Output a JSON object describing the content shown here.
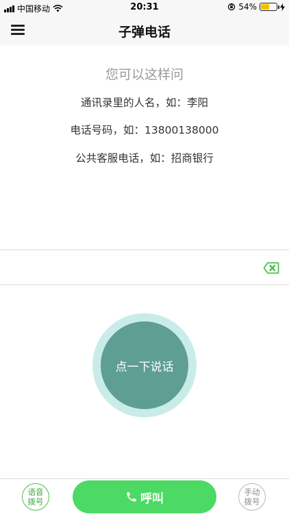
{
  "status_bar": {
    "carrier": "中国移动",
    "time": "20:31",
    "battery_percent": "54%",
    "battery_level": 0.54
  },
  "nav": {
    "title": "子弹电话",
    "menu_icon": "hamburger-menu-icon"
  },
  "hints": {
    "title": "您可以这样问",
    "items": [
      "通讯录里的人名，如：李阳",
      "电话号码，如：13800138000",
      "公共客服电话，如：招商银行"
    ]
  },
  "input": {
    "value": "",
    "clear_icon": "backspace-icon"
  },
  "speak_button": {
    "label": "点一下说话"
  },
  "bottom_bar": {
    "voice_dial": {
      "line1": "语音",
      "line2": "拨号"
    },
    "call_label": "呼叫",
    "call_icon": "phone-icon",
    "manual_dial": {
      "line1": "手动",
      "line2": "拨号"
    }
  },
  "colors": {
    "accent_green": "#4cd964",
    "speak_inner": "#5e9e93",
    "speak_outer": "#c9ece9",
    "battery_fill": "#f2c200"
  }
}
